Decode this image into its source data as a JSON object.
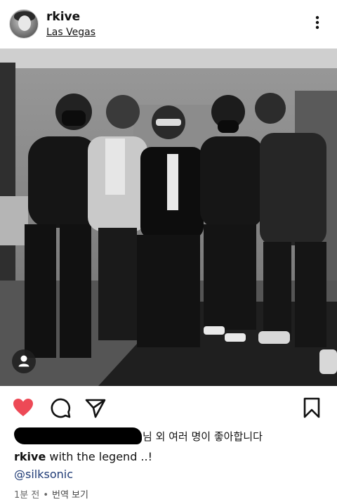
{
  "post": {
    "username": "rkive",
    "location": "Las Vegas",
    "likes_suffix": "님 외 여러 명이 좋아합니다",
    "caption_user": "rkive",
    "caption_text": " with the legend ..!",
    "mention": "@silksonic",
    "time_ago": "1분 전",
    "separator": "•",
    "translate": "번역 보기"
  },
  "icons": {
    "more": "more-vertical-icon",
    "like": "heart-filled-icon",
    "comment": "comment-icon",
    "share": "send-icon",
    "save": "bookmark-icon",
    "tag": "user-tag-icon"
  },
  "colors": {
    "like": "#ed4956",
    "mention": "#1e3a75",
    "meta": "#666666"
  }
}
